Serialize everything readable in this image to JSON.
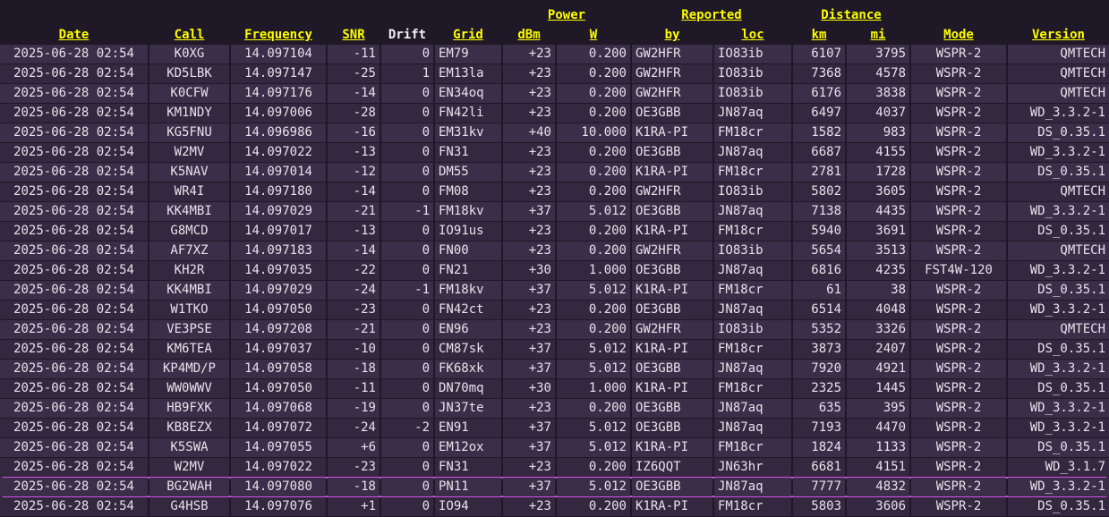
{
  "group_headers": {
    "power": "Power",
    "reported": "Reported",
    "distance": "Distance"
  },
  "columns": {
    "date": "Date",
    "call": "Call",
    "frequency": "Frequency",
    "snr": "SNR",
    "drift": "Drift",
    "grid": "Grid",
    "dbm": "dBm",
    "w": "W",
    "by": "by",
    "loc": "loc",
    "km": "km",
    "mi": "mi",
    "mode": "Mode",
    "version": "Version"
  },
  "rows": [
    [
      "2025-06-28 02:54",
      "K0XG",
      "14.097104",
      "-11",
      "0",
      "EM79",
      "+23",
      "0.200",
      "GW2HFR",
      "IO83ib",
      "6107",
      "3795",
      "WSPR-2",
      "QMTECH"
    ],
    [
      "2025-06-28 02:54",
      "KD5LBK",
      "14.097147",
      "-25",
      "1",
      "EM13la",
      "+23",
      "0.200",
      "GW2HFR",
      "IO83ib",
      "7368",
      "4578",
      "WSPR-2",
      "QMTECH"
    ],
    [
      "2025-06-28 02:54",
      "K0CFW",
      "14.097176",
      "-14",
      "0",
      "EN34oq",
      "+23",
      "0.200",
      "GW2HFR",
      "IO83ib",
      "6176",
      "3838",
      "WSPR-2",
      "QMTECH"
    ],
    [
      "2025-06-28 02:54",
      "KM1NDY",
      "14.097006",
      "-28",
      "0",
      "FN42li",
      "+23",
      "0.200",
      "OE3GBB",
      "JN87aq",
      "6497",
      "4037",
      "WSPR-2",
      "WD_3.3.2-1"
    ],
    [
      "2025-06-28 02:54",
      "KG5FNU",
      "14.096986",
      "-16",
      "0",
      "EM31kv",
      "+40",
      "10.000",
      "K1RA-PI",
      "FM18cr",
      "1582",
      "983",
      "WSPR-2",
      "DS_0.35.1"
    ],
    [
      "2025-06-28 02:54",
      "W2MV",
      "14.097022",
      "-13",
      "0",
      "FN31",
      "+23",
      "0.200",
      "OE3GBB",
      "JN87aq",
      "6687",
      "4155",
      "WSPR-2",
      "WD_3.3.2-1"
    ],
    [
      "2025-06-28 02:54",
      "K5NAV",
      "14.097014",
      "-12",
      "0",
      "DM55",
      "+23",
      "0.200",
      "K1RA-PI",
      "FM18cr",
      "2781",
      "1728",
      "WSPR-2",
      "DS_0.35.1"
    ],
    [
      "2025-06-28 02:54",
      "WR4I",
      "14.097180",
      "-14",
      "0",
      "FM08",
      "+23",
      "0.200",
      "GW2HFR",
      "IO83ib",
      "5802",
      "3605",
      "WSPR-2",
      "QMTECH"
    ],
    [
      "2025-06-28 02:54",
      "KK4MBI",
      "14.097029",
      "-21",
      "-1",
      "FM18kv",
      "+37",
      "5.012",
      "OE3GBB",
      "JN87aq",
      "7138",
      "4435",
      "WSPR-2",
      "WD_3.3.2-1"
    ],
    [
      "2025-06-28 02:54",
      "G8MCD",
      "14.097017",
      "-13",
      "0",
      "IO91us",
      "+23",
      "0.200",
      "K1RA-PI",
      "FM18cr",
      "5940",
      "3691",
      "WSPR-2",
      "DS_0.35.1"
    ],
    [
      "2025-06-28 02:54",
      "AF7XZ",
      "14.097183",
      "-14",
      "0",
      "FN00",
      "+23",
      "0.200",
      "GW2HFR",
      "IO83ib",
      "5654",
      "3513",
      "WSPR-2",
      "QMTECH"
    ],
    [
      "2025-06-28 02:54",
      "KH2R",
      "14.097035",
      "-22",
      "0",
      "FN21",
      "+30",
      "1.000",
      "OE3GBB",
      "JN87aq",
      "6816",
      "4235",
      "FST4W-120",
      "WD_3.3.2-1"
    ],
    [
      "2025-06-28 02:54",
      "KK4MBI",
      "14.097029",
      "-24",
      "-1",
      "FM18kv",
      "+37",
      "5.012",
      "K1RA-PI",
      "FM18cr",
      "61",
      "38",
      "WSPR-2",
      "DS_0.35.1"
    ],
    [
      "2025-06-28 02:54",
      "W1TKO",
      "14.097050",
      "-23",
      "0",
      "FN42ct",
      "+23",
      "0.200",
      "OE3GBB",
      "JN87aq",
      "6514",
      "4048",
      "WSPR-2",
      "WD_3.3.2-1"
    ],
    [
      "2025-06-28 02:54",
      "VE3PSE",
      "14.097208",
      "-21",
      "0",
      "EN96",
      "+23",
      "0.200",
      "GW2HFR",
      "IO83ib",
      "5352",
      "3326",
      "WSPR-2",
      "QMTECH"
    ],
    [
      "2025-06-28 02:54",
      "KM6TEA",
      "14.097037",
      "-10",
      "0",
      "CM87sk",
      "+37",
      "5.012",
      "K1RA-PI",
      "FM18cr",
      "3873",
      "2407",
      "WSPR-2",
      "DS_0.35.1"
    ],
    [
      "2025-06-28 02:54",
      "KP4MD/P",
      "14.097058",
      "-18",
      "0",
      "FK68xk",
      "+37",
      "5.012",
      "OE3GBB",
      "JN87aq",
      "7920",
      "4921",
      "WSPR-2",
      "WD_3.3.2-1"
    ],
    [
      "2025-06-28 02:54",
      "WW0WWV",
      "14.097050",
      "-11",
      "0",
      "DN70mq",
      "+30",
      "1.000",
      "K1RA-PI",
      "FM18cr",
      "2325",
      "1445",
      "WSPR-2",
      "DS_0.35.1"
    ],
    [
      "2025-06-28 02:54",
      "HB9FXK",
      "14.097068",
      "-19",
      "0",
      "JN37te",
      "+23",
      "0.200",
      "OE3GBB",
      "JN87aq",
      "635",
      "395",
      "WSPR-2",
      "WD_3.3.2-1"
    ],
    [
      "2025-06-28 02:54",
      "KB8EZX",
      "14.097072",
      "-24",
      "-2",
      "EN91",
      "+37",
      "5.012",
      "OE3GBB",
      "JN87aq",
      "7193",
      "4470",
      "WSPR-2",
      "WD_3.3.2-1"
    ],
    [
      "2025-06-28 02:54",
      "K5SWA",
      "14.097055",
      "+6",
      "0",
      "EM12ox",
      "+37",
      "5.012",
      "K1RA-PI",
      "FM18cr",
      "1824",
      "1133",
      "WSPR-2",
      "DS_0.35.1"
    ],
    [
      "2025-06-28 02:54",
      "W2MV",
      "14.097022",
      "-23",
      "0",
      "FN31",
      "+23",
      "0.200",
      "IZ6QQT",
      "JN63hr",
      "6681",
      "4151",
      "WSPR-2",
      "WD_3.1.7"
    ],
    [
      "2025-06-28 02:54",
      "BG2WAH",
      "14.097080",
      "-18",
      "0",
      "PN11",
      "+37",
      "5.012",
      "OE3GBB",
      "JN87aq",
      "7777",
      "4832",
      "WSPR-2",
      "WD_3.3.2-1"
    ],
    [
      "2025-06-28 02:54",
      "G4HSB",
      "14.097076",
      "+1",
      "0",
      "IO94",
      "+23",
      "0.200",
      "K1RA-PI",
      "FM18cr",
      "5803",
      "3606",
      "WSPR-2",
      "DS_0.35.1"
    ]
  ],
  "highlighted_call": "BG2WAH"
}
